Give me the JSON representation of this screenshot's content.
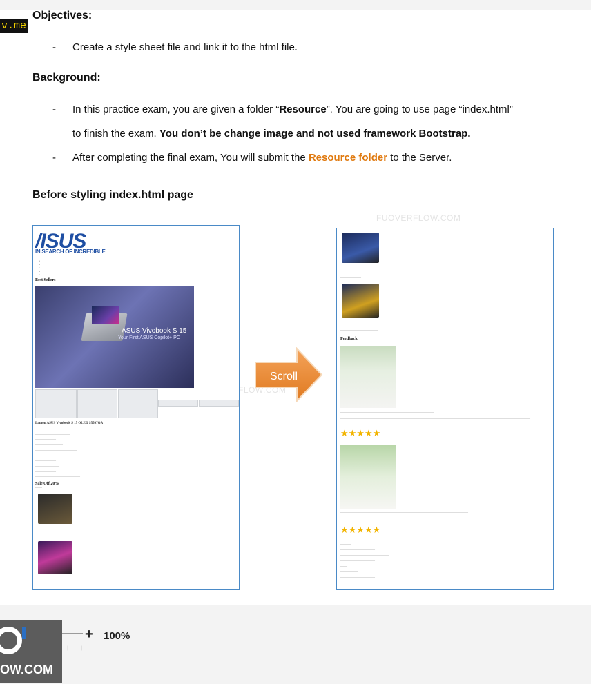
{
  "corner_tag": "v.me",
  "objectives": {
    "heading": "Objectives:",
    "items": [
      "Create a style sheet file and link it to the html file."
    ]
  },
  "background": {
    "heading": "Background:",
    "item1_prefix": "In this practice exam, you are given a folder “",
    "item1_folder": "Resource",
    "item1_suffix": "”. You are going to use page “index.html”",
    "item1_line2_plain": "to finish the exam. ",
    "item1_line2_bold": "You don’t be change image and not used framework Bootstrap.",
    "item2_prefix": "After completing the final exam, You will submit the ",
    "item2_folder": "Resource folder",
    "item2_suffix": " to the Server."
  },
  "before_heading": "Before styling index.html page",
  "arrow_label": "Scroll",
  "left_page": {
    "logo": "/ISUS",
    "tagline": "IN SEARCH OF INCREDIBLE",
    "best_sellers": "Best Sellers",
    "banner_title": "ASUS Vivobook S 15",
    "banner_sub": "Your First ASUS Copilot+ PC",
    "product_title": "Laptop ASUS Vivobook S 15 OLED S5507QA",
    "sale": "Sale Off 20%"
  },
  "right_page": {
    "feedback": "Feedback",
    "stars": "★★★★★"
  },
  "watermark": "FUOVERFLOW.COM",
  "bottom_bar": {
    "zoom_plus": "+",
    "zoom_level": "100%",
    "logo_text": "OW.COM"
  }
}
